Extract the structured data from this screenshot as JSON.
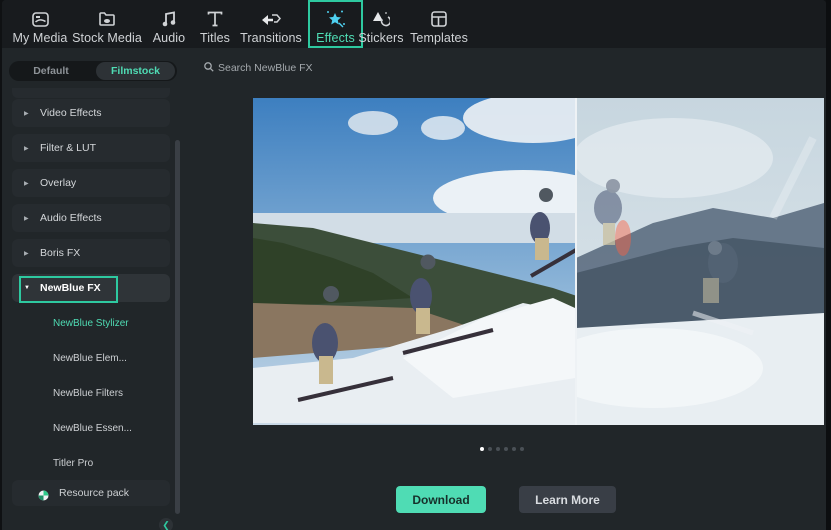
{
  "toolbar": {
    "tabs": [
      {
        "label": "My Media",
        "icon": "media-icon"
      },
      {
        "label": "Stock Media",
        "icon": "stock-media-icon"
      },
      {
        "label": "Audio",
        "icon": "music-note-icon"
      },
      {
        "label": "Titles",
        "icon": "title-t-icon"
      },
      {
        "label": "Transitions",
        "icon": "transition-arrows-icon"
      },
      {
        "label": "Effects",
        "icon": "sparkle-star-icon",
        "active": true
      },
      {
        "label": "Stickers",
        "icon": "sticker-icon"
      },
      {
        "label": "Templates",
        "icon": "template-grid-icon"
      }
    ]
  },
  "sidebar": {
    "segment": {
      "default": "Default",
      "filmstock": "Filmstock",
      "selected": "Filmstock"
    },
    "categories": [
      {
        "label": "Video Effects",
        "expanded": false
      },
      {
        "label": "Filter & LUT",
        "expanded": false
      },
      {
        "label": "Overlay",
        "expanded": false
      },
      {
        "label": "Audio Effects",
        "expanded": false
      },
      {
        "label": "Boris FX",
        "expanded": false
      },
      {
        "label": "NewBlue FX",
        "expanded": true
      }
    ],
    "subitems": [
      {
        "label": "NewBlue Stylizer",
        "active": true
      },
      {
        "label": "NewBlue Elem..."
      },
      {
        "label": "NewBlue Filters"
      },
      {
        "label": "NewBlue Essen..."
      },
      {
        "label": "Titler Pro"
      }
    ],
    "resource_pack": "Resource pack"
  },
  "main": {
    "search_placeholder": "Search NewBlue FX",
    "preview_alt": "Snowboarder jump sequence, before/after NewBlue Stylizer comparison",
    "carousel": {
      "count": 6,
      "active_index": 0
    },
    "download_label": "Download",
    "learn_more_label": "Learn More"
  },
  "colors": {
    "accent": "#4fdcb4",
    "highlight_border": "#2ec9a0",
    "topbar_bg": "#181b1e",
    "panel_bg": "#212629"
  }
}
